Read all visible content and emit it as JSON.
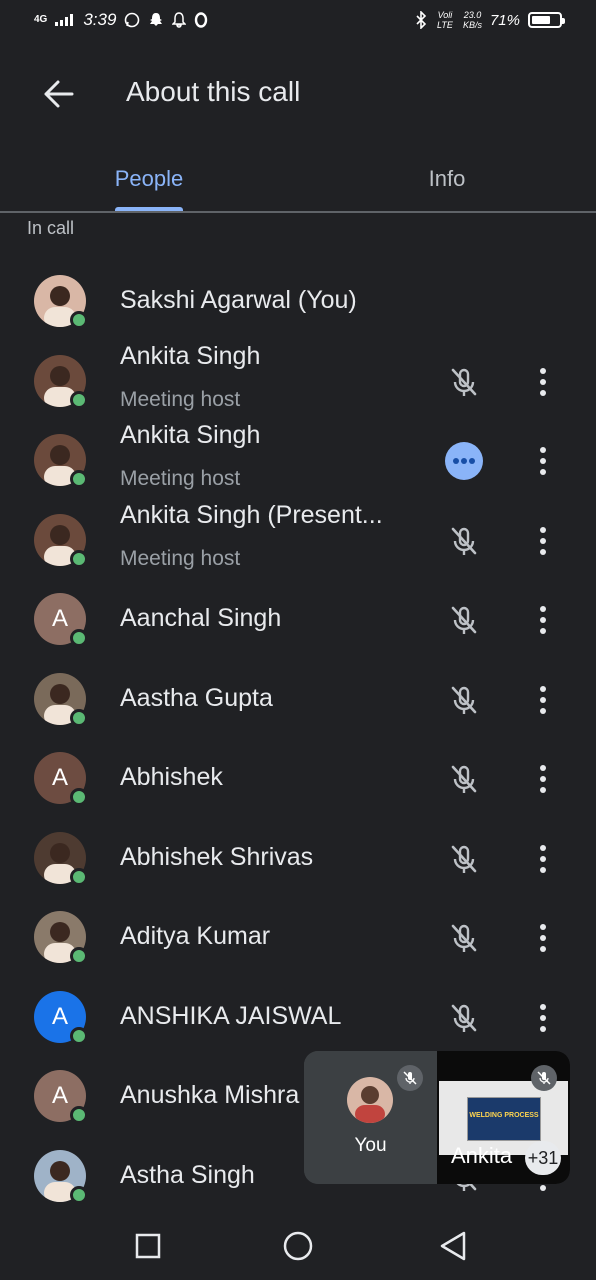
{
  "status_bar": {
    "network": "4G",
    "time": "3:39",
    "lte": "Voli LTE",
    "speed_value": "23.0",
    "speed_unit": "KB/s",
    "battery_percent": "71%",
    "battery_level": 0.71
  },
  "header": {
    "title": "About this call"
  },
  "tabs": [
    {
      "label": "People",
      "selected": true
    },
    {
      "label": "Info",
      "selected": false
    }
  ],
  "section_label": "In call",
  "participants": [
    {
      "initial": "",
      "avatar_color": "#d9b7a6",
      "name": "Sakshi Agarwal (You)",
      "role": "",
      "status": "self"
    },
    {
      "initial": "",
      "avatar_color": "#6b4a3c",
      "name": "Ankita Singh",
      "role": "Meeting host",
      "status": "muted"
    },
    {
      "initial": "",
      "avatar_color": "#6b4a3c",
      "name": "Ankita Singh",
      "role": "Meeting host",
      "status": "speaking"
    },
    {
      "initial": "",
      "avatar_color": "#6b4a3c",
      "name": "Ankita Singh (Present...",
      "role": "Meeting host",
      "status": "muted"
    },
    {
      "initial": "A",
      "avatar_color": "#8d6e63",
      "name": "Aanchal Singh",
      "role": "",
      "status": "muted"
    },
    {
      "initial": "",
      "avatar_color": "#7a6a5a",
      "name": "Aastha Gupta",
      "role": "",
      "status": "muted"
    },
    {
      "initial": "A",
      "avatar_color": "#6d4c41",
      "name": "Abhishek",
      "role": "",
      "status": "muted"
    },
    {
      "initial": "",
      "avatar_color": "#4e3b31",
      "name": "Abhishek Shrivas",
      "role": "",
      "status": "muted"
    },
    {
      "initial": "",
      "avatar_color": "#8a7a6a",
      "name": "Aditya Kumar",
      "role": "",
      "status": "muted"
    },
    {
      "initial": "A",
      "avatar_color": "#1a73e8",
      "name": "ANSHIKA JAISWAL",
      "role": "",
      "status": "muted"
    },
    {
      "initial": "A",
      "avatar_color": "#8d6e63",
      "name": "Anushka Mishra",
      "role": "",
      "status": "muted"
    },
    {
      "initial": "",
      "avatar_color": "#9fb3c8",
      "name": "Astha Singh",
      "role": "",
      "status": "muted"
    }
  ],
  "pip": {
    "self_label": "You",
    "other_label": "Ankita",
    "others_count": "+31",
    "slide_text": "WELDING PROCESS"
  }
}
